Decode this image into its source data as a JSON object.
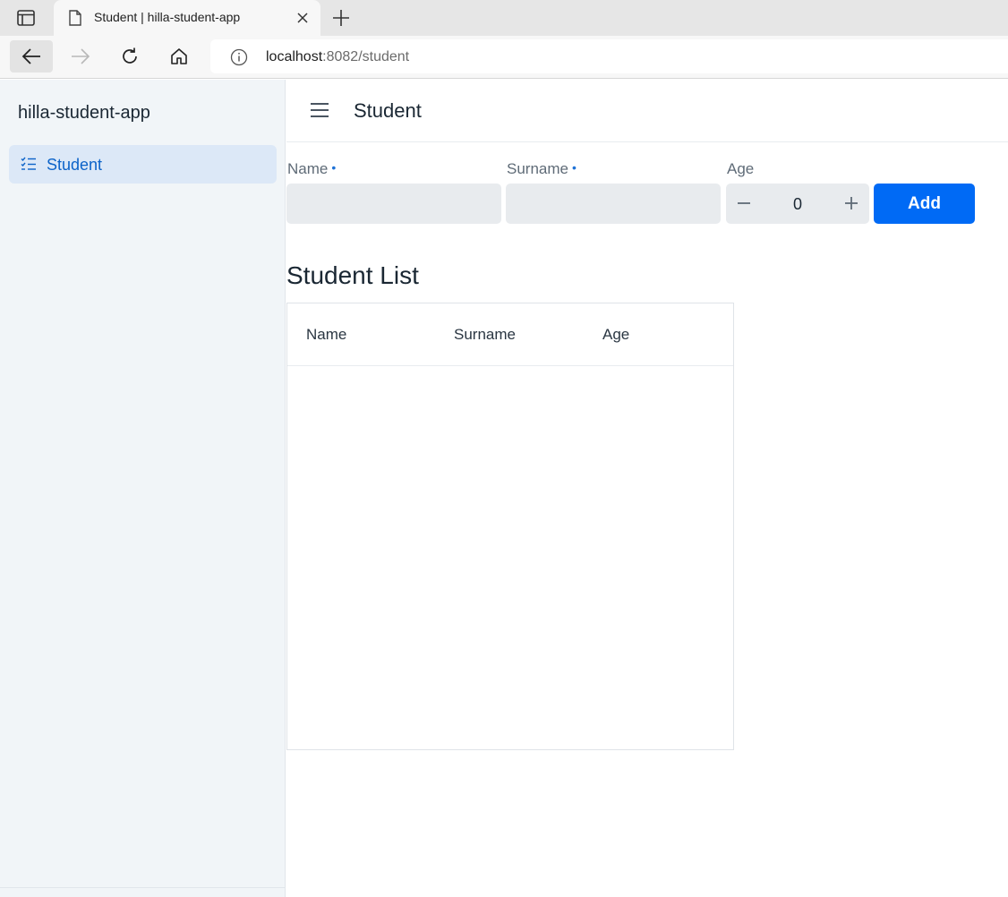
{
  "browser": {
    "tab_title": "Student | hilla-student-app",
    "address_host": "localhost",
    "address_path": ":8082/student"
  },
  "app": {
    "name": "hilla-student-app",
    "nav_items": [
      {
        "label": "Student",
        "icon": "checklist-icon",
        "active": true
      }
    ]
  },
  "navbar": {
    "title": "Student"
  },
  "form": {
    "name_label": "Name",
    "surname_label": "Surname",
    "age_label": "Age",
    "required_marker": "•",
    "name_value": "",
    "surname_value": "",
    "age_value": "0",
    "add_label": "Add"
  },
  "list": {
    "title": "Student List",
    "columns": [
      "Name",
      "Surname",
      "Age"
    ],
    "rows": []
  },
  "colors": {
    "accent": "#006af5",
    "nav_active_bg": "#dce8f7",
    "nav_active_text": "#0c63c9",
    "drawer_bg": "#f1f5f8",
    "field_bg": "#e8ebee"
  }
}
